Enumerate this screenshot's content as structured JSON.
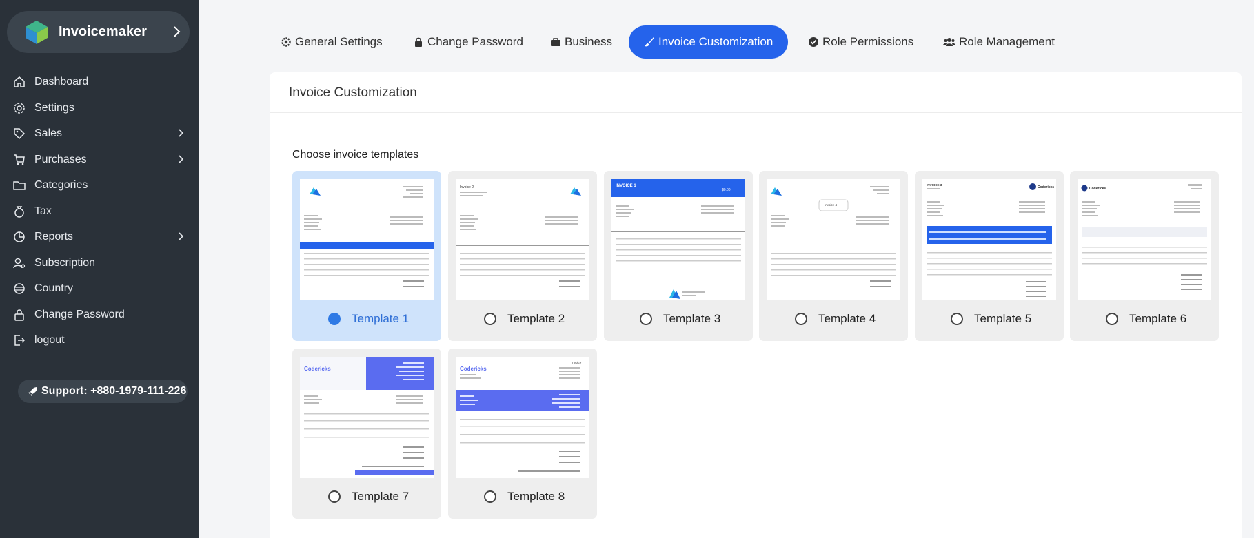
{
  "brand": {
    "name": "Invoicemaker"
  },
  "sidebar": {
    "items": [
      {
        "label": "Dashboard",
        "icon": "home-icon"
      },
      {
        "label": "Settings",
        "icon": "gear-icon"
      },
      {
        "label": "Sales",
        "icon": "tag-icon"
      },
      {
        "label": "Purchases",
        "icon": "cart-icon"
      },
      {
        "label": "Categories",
        "icon": "folder-icon"
      },
      {
        "label": "Tax",
        "icon": "money-bag-icon"
      },
      {
        "label": "Reports",
        "icon": "pie-chart-icon"
      },
      {
        "label": "Subscription",
        "icon": "user-gear-icon"
      },
      {
        "label": "Country",
        "icon": "globe-icon"
      },
      {
        "label": "Change Password",
        "icon": "lock-icon"
      },
      {
        "label": "logout",
        "icon": "logout-icon"
      }
    ],
    "support": "Support: +880-1979-111-226"
  },
  "tabs": [
    {
      "label": "General Settings",
      "icon": "gear-icon"
    },
    {
      "label": "Change Password",
      "icon": "lock-icon"
    },
    {
      "label": "Business",
      "icon": "briefcase-icon"
    },
    {
      "label": "Invoice Customization",
      "icon": "brush-icon"
    },
    {
      "label": "Role Permissions",
      "icon": "check-circle-icon"
    },
    {
      "label": "Role Management",
      "icon": "users-icon"
    }
  ],
  "card": {
    "title": "Invoice Customization",
    "section_title": "Choose invoice templates"
  },
  "templates": [
    {
      "label": "Template 1"
    },
    {
      "label": "Template 2"
    },
    {
      "label": "Template 3"
    },
    {
      "label": "Template 4"
    },
    {
      "label": "Template 5"
    },
    {
      "label": "Template 6"
    },
    {
      "label": "Template 7"
    },
    {
      "label": "Template 8"
    }
  ],
  "thumbnail_text": {
    "invoice_1": "INVOICE 1",
    "amount": "$0.00",
    "invoice_2": "Invoice 2",
    "invoice_3": "INVOICE 3",
    "invoice_4": "Invoice 4",
    "codericks": "Codericks",
    "invoice": "Invoice"
  },
  "colors": {
    "accent": "#2563eb",
    "sidebar": "#2a3139",
    "selected_card": "#cfe3fb",
    "template_purple": "#5a6cf0"
  }
}
